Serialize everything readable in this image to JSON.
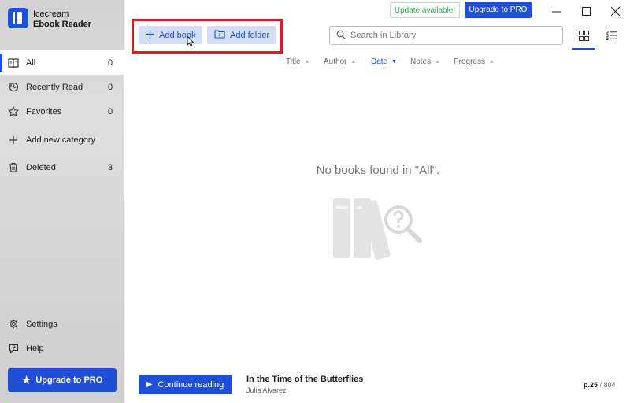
{
  "app": {
    "name_line1": "Icecream",
    "name_line2": "Ebook Reader"
  },
  "sidebar": {
    "items": [
      {
        "label": "All",
        "count": "0",
        "icon": "book-open-icon"
      },
      {
        "label": "Recently Read",
        "count": "0",
        "icon": "history-icon"
      },
      {
        "label": "Favorites",
        "count": "0",
        "icon": "star-icon"
      },
      {
        "label": "Add new category",
        "count": "",
        "icon": "plus-icon"
      },
      {
        "label": "Deleted",
        "count": "3",
        "icon": "trash-icon"
      }
    ],
    "settings_label": "Settings",
    "help_label": "Help",
    "upgrade_label": "Upgrade to PRO"
  },
  "topbar": {
    "update_label": "Update available!",
    "upgrade_label": "Upgrade to PRO"
  },
  "toolbar": {
    "add_book_label": "Add book",
    "add_folder_label": "Add folder",
    "search_placeholder": "Search in Library"
  },
  "columns": [
    "Title",
    "Author",
    "Date",
    "Notes",
    "Progress"
  ],
  "active_column": "Date",
  "empty_state": {
    "message": "No books found in \"All\"."
  },
  "bottom_bar": {
    "continue_label": "Continue reading",
    "book_title": "In the Time of the Butterflies",
    "book_author": "Julia Alvarez",
    "page_current": "p.25",
    "page_total": "/ 804"
  },
  "colors": {
    "accent": "#1f4fd6",
    "highlight": "#e01b24",
    "update_green": "#2da44e"
  }
}
